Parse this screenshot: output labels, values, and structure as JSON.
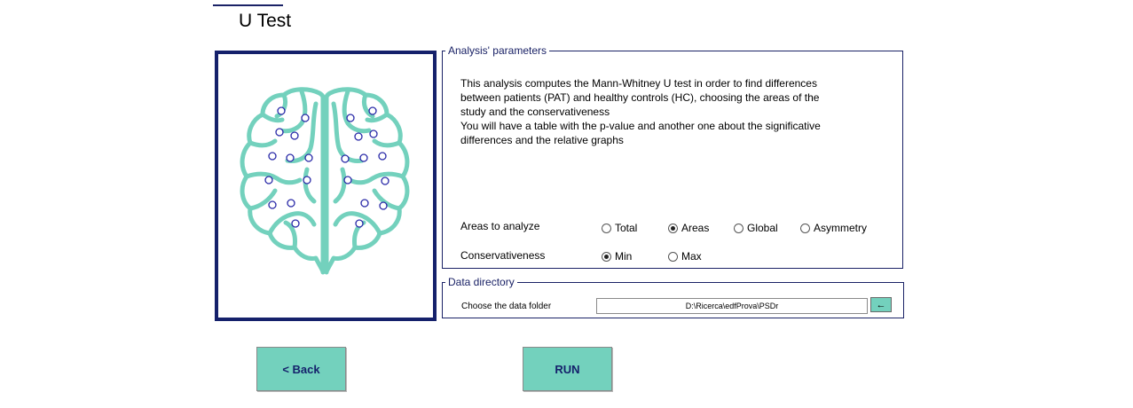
{
  "header": {
    "title": "U Test"
  },
  "image": {
    "icon": "brain-icon",
    "accent": "#73d1bd",
    "border_color": "#15216b"
  },
  "analysis_parameters": {
    "legend": "Analysis' parameters",
    "description": [
      "This analysis computes the Mann-Whitney U test in order to find differences",
      "between patients (PAT) and healthy controls (HC), choosing the areas of the",
      "study and the conservativeness",
      "You will have a table with the p-value and another one about the significative",
      "differences and the relative graphs"
    ],
    "areas": {
      "label": "Areas to analyze",
      "options": [
        "Total",
        "Areas",
        "Global",
        "Asymmetry"
      ],
      "selected": "Areas"
    },
    "conservativeness": {
      "label": "Conservativeness",
      "options": [
        "Min",
        "Max"
      ],
      "selected": "Min"
    }
  },
  "data_directory": {
    "legend": "Data directory",
    "label": "Choose the data folder",
    "value": "D:\\Ricerca\\edfProva\\PSDr",
    "browse_icon": "←"
  },
  "buttons": {
    "back": "<  Back",
    "run": "RUN"
  },
  "colors": {
    "button": "#73d1bd",
    "navy": "#15216b"
  }
}
